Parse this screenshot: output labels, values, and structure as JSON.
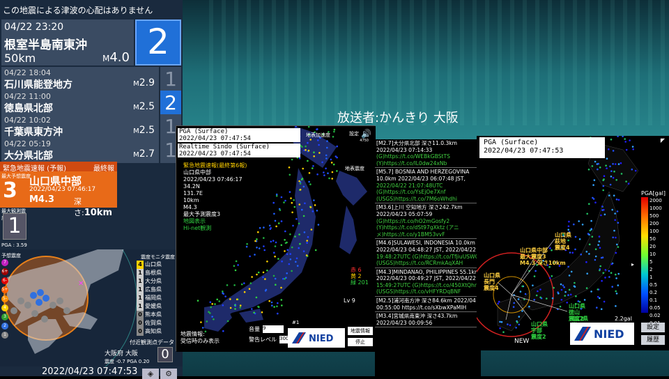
{
  "header": {
    "tsunami_text": "この地震による津波の心配はありません",
    "broadcaster_text": "放送者:かんきり 大阪"
  },
  "latest_quake": {
    "time": "04/22 23:20",
    "place": "根室半島南東沖",
    "depth": "50km",
    "mag_prefix": "M",
    "magnitude": "4.0",
    "intensity": "2"
  },
  "quake_history": [
    {
      "time": "04/22 18:04",
      "place": "石川県能登地方",
      "mag_prefix": "M",
      "magnitude": "2.9",
      "intensity": "1"
    },
    {
      "time": "04/22 11:00",
      "place": "徳島県北部",
      "mag_prefix": "M",
      "magnitude": "2.5",
      "intensity": "2"
    },
    {
      "time": "04/22 10:02",
      "place": "千葉県東方沖",
      "mag_prefix": "M",
      "magnitude": "2.5",
      "intensity": "1"
    },
    {
      "time": "04/22 05:19",
      "place": "大分県北部",
      "mag_prefix": "M",
      "magnitude": "2.7",
      "intensity": "1"
    }
  ],
  "eew": {
    "header": "緊急地震速報 (予報)",
    "final_label": "最終報",
    "max_label": "最大予想震度",
    "intensity": "3",
    "place": "山口県中部",
    "time": "2022/04/23 07:46:17",
    "magnitude": "M4.3",
    "depth_label": "深さ:",
    "depth": "10km"
  },
  "observed": {
    "label": "最大観測震度",
    "intensity": "1",
    "pga": "PGA : 3.59"
  },
  "left_map": {
    "legend_title": "予想震度",
    "legend": [
      "7",
      "6+",
      "6-",
      "5+",
      "5-",
      "4",
      "3",
      "2",
      "1"
    ],
    "legend_colors": [
      "#c020c0",
      "#a00000",
      "#e00000",
      "#ff6000",
      "#ff9000",
      "#ffd000",
      "#30a030",
      "#3070e0",
      "#888888"
    ]
  },
  "monitor": {
    "title": "震度モニタ震度",
    "rows": [
      {
        "i": "4",
        "name": "山口県",
        "color": "#ffd000"
      },
      {
        "i": "1",
        "name": "島根県",
        "color": "#cccccc"
      },
      {
        "i": "1",
        "name": "大分県",
        "color": "#cccccc"
      },
      {
        "i": "1",
        "name": "広島県",
        "color": "#cccccc"
      },
      {
        "i": "1",
        "name": "福岡県",
        "color": "#cccccc"
      },
      {
        "i": "1",
        "name": "愛媛県",
        "color": "#cccccc"
      },
      {
        "i": "0",
        "name": "熊本県",
        "color": "#888888"
      },
      {
        "i": "0",
        "name": "佐賀県",
        "color": "#888888"
      },
      {
        "i": "0",
        "name": "高知県",
        "color": "#888888"
      }
    ]
  },
  "nearby": {
    "title": "付近観測点データ",
    "city": "大阪府 大阪",
    "intensity": "0",
    "stats": "震度 -0.7  PGA 0.20"
  },
  "footer": {
    "clock": "2022/04/23 07:47:53",
    "btn1": "◈",
    "btn2": "⚙"
  },
  "kmoni": {
    "box1_l1": "PGA (Surface)",
    "box1_l2": "2022/04/23 07:47:54",
    "box2_l1": "Realtime Sindo (Surface)",
    "box2_l2": "2022/04/23 07:47:54",
    "info_title": "緊急地震速報(最終第6報)",
    "info_lines": [
      "山口県中部",
      "2022/04/23 07:46:17",
      "34.2N",
      "131.7E",
      "10km",
      "M4.3",
      "最大予測震度3"
    ],
    "info_green": [
      "地図表示",
      "Hi-net観測"
    ],
    "right_top": "地表加速度",
    "right_mid": "地表震度",
    "settings": "設定",
    "speaker": "🔊",
    "tick": "4750",
    "count_red": "赤 6",
    "count_yellow": "黄 2",
    "count_green": "緑 201",
    "level": "Lv 9",
    "bottom_l1": "地震情報:",
    "bottom_l2": "受信時のみ表示",
    "volume_label": "音量",
    "volume_value": "9",
    "alert_label": "警告レベル",
    "alert_value": "300",
    "sec": "#1",
    "info_btn": "地震情報",
    "stop_btn": "停止",
    "logo": "NIED"
  },
  "tweets": [
    {
      "l1": "[M2.7]大分県北部 深さ11.0.3km",
      "l2": "2022/04/23 07:14:33",
      "l3": "(G)https://t.co/WEBkGBStTS",
      "l4": "(Y)https://t.co/lL0dw24xNb"
    },
    {
      "l1": "[M5.7] BOSNIA AND HERZEGOVINA",
      "l2": "10.0km 2022/04/23 06:07:48 JST,",
      "l3": "2022/04/22 21:07:48UTC",
      "l4": "(G)https://t.co/YsEjOe7Xnf",
      "l5": "(USGS)https://t.co/7M6oWhdhi"
    },
    {
      "l1": "[M3.6]上川 空知地方 深さ242.7km",
      "l2": "2022/04/23 05:07:59",
      "l3": "(G)https://t.co/hO2mGosfy2",
      "l4": "(Y)https://t.co/dSt97gXktz (アニ",
      "l5": "メ)https://t.co/y1BM53vvF"
    },
    {
      "l1": "[M4.6]SULAWESI, INDONESIA 10.0km",
      "l2": "2022/04/23 04:48:27 JST, 2022/04/22",
      "l3": "19:48:27UTC (G)https://t.co/TfjiuUSWG",
      "l4": "(USGS)https://t.co/RCRmkAqXAH"
    },
    {
      "l1": "[M4.3]MINDANAO, PHILIPPINES 55.1km",
      "l2": "2022/04/23 00:49:27 JST, 2022/04/22",
      "l3": "15:49:27UTC (G)https://t.co/450XtQhn",
      "l4": "(USGS)https://t.co/vHFYRDqBNF"
    },
    {
      "l1": "[M2.5]浦河南方沖 深さ84.6km 2022/04",
      "l2": "00:55:00 https://t.co/sXbwXPaMlH"
    },
    {
      "l1": "[M3.4]宮城県南東沖 深さ43.7km",
      "l2": "2022/04/23 00:09:56"
    }
  ],
  "pga_map": {
    "box_l1": "PGA (Surface)",
    "box_l2": "2022/04/23 07:47:53",
    "scale_title": "PGA[gal]",
    "scale_labels": [
      "2000",
      "1000",
      "500",
      "200",
      "100",
      "50",
      "20",
      "10",
      "5",
      "2",
      "1",
      "0.5",
      "0.2",
      "0.1",
      "0.05",
      "0.02",
      "0.01"
    ],
    "gal": "2.2gal",
    "new_label": "NEW",
    "btn_settings": "設定",
    "btn_history": "履歴",
    "arrow": "▸",
    "tri": "◤",
    "logo": "NIED",
    "annotations": [
      {
        "t": "山口県中部\n最大震度3\nM4.3 深さ10km",
        "c": "#ffcf40"
      },
      {
        "t": "山口県\n萩地\n震度4",
        "c": "#ffcf40"
      },
      {
        "t": "山口県\n長門\n震度4",
        "c": "#ffcf40"
      },
      {
        "t": "山口県\n宇部\n震度2",
        "c": "#30d040"
      },
      {
        "t": "山口県\n徳山\n震度2",
        "c": "#30d040"
      },
      {
        "t": "山口県\n光\n震度2",
        "c": "#30d040"
      }
    ]
  }
}
